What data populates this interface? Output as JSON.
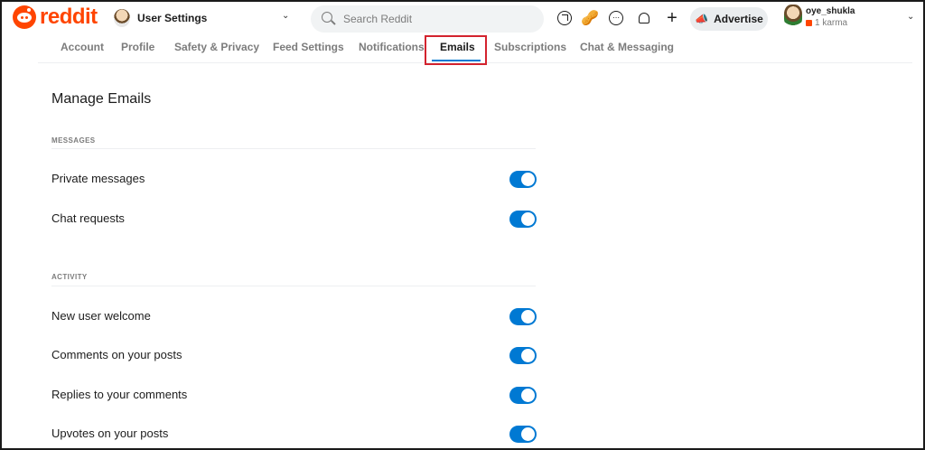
{
  "header": {
    "logo_text": "reddit",
    "context_label": "User Settings",
    "search_placeholder": "Search Reddit",
    "advertise_label": "Advertise",
    "username": "oye_shukla",
    "karma": "1 karma",
    "icons": [
      "popular-arrow-icon",
      "coins-icon",
      "chat-icon",
      "bell-icon",
      "plus-icon",
      "megaphone-icon"
    ]
  },
  "tabs": [
    {
      "label": "Account"
    },
    {
      "label": "Profile"
    },
    {
      "label": "Safety & Privacy"
    },
    {
      "label": "Feed Settings"
    },
    {
      "label": "Notifications"
    },
    {
      "label": "Emails",
      "active": true
    },
    {
      "label": "Subscriptions"
    },
    {
      "label": "Chat & Messaging"
    }
  ],
  "main": {
    "title": "Manage Emails",
    "sections": [
      {
        "label": "MESSAGES",
        "items": [
          {
            "label": "Private messages",
            "enabled": true
          },
          {
            "label": "Chat requests",
            "enabled": true
          }
        ]
      },
      {
        "label": "ACTIVITY",
        "items": [
          {
            "label": "New user welcome",
            "enabled": true
          },
          {
            "label": "Comments on your posts",
            "enabled": true
          },
          {
            "label": "Replies to your comments",
            "enabled": true
          },
          {
            "label": "Upvotes on your posts",
            "enabled": true
          }
        ]
      }
    ]
  },
  "colors": {
    "brand": "#ff4500",
    "toggle_on": "#0079d3",
    "highlight": "#d3232e"
  }
}
